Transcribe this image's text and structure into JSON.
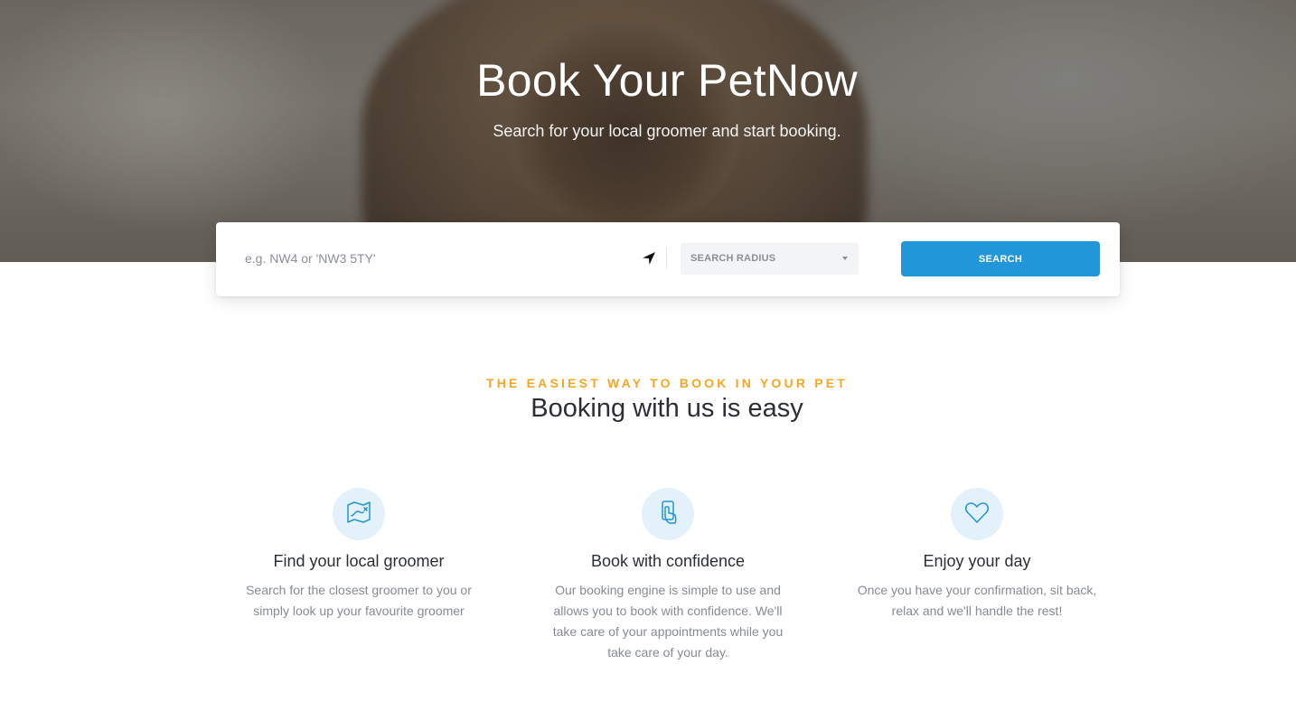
{
  "hero": {
    "title": "Book Your PetNow",
    "subtitle": "Search for your local groomer and start booking."
  },
  "search": {
    "placeholder": "e.g. NW4 or 'NW3 5TY'",
    "locate_icon": "location-arrow-icon",
    "radius_label": "SEARCH RADIUS",
    "button_label": "SEARCH",
    "button_color": "#2196d8"
  },
  "section": {
    "eyebrow": "THE EASIEST WAY TO BOOK IN YOUR PET",
    "eyebrow_color": "#f5a623",
    "title": "Booking with us is easy"
  },
  "features": [
    {
      "icon": "map-route-icon",
      "title": "Find your local groomer",
      "text": "Search for the closest groomer to you or simply look up your favourite groomer"
    },
    {
      "icon": "tap-card-icon",
      "title": "Book with confidence",
      "text": "Our booking engine is simple to use and allows you to book with confidence. We'll take care of your appointments while you take care of your day."
    },
    {
      "icon": "heart-icon",
      "title": "Enjoy your day",
      "text": "Once you have your confirmation, sit back, relax and we'll handle the rest!"
    }
  ]
}
